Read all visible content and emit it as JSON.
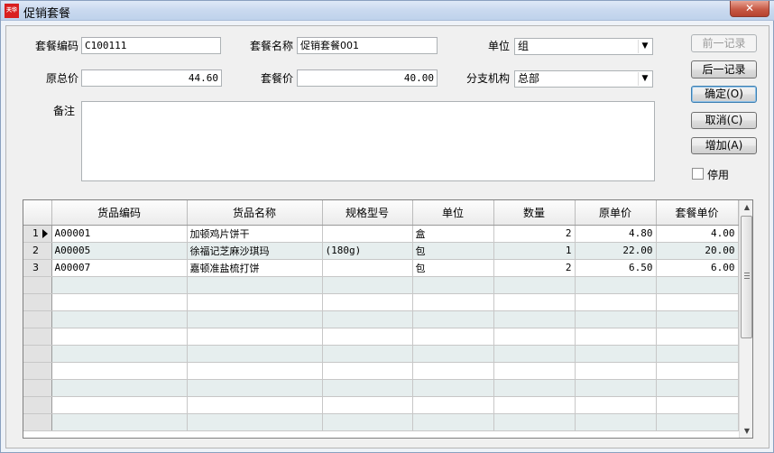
{
  "window": {
    "title": "促销套餐",
    "app_icon_text": "天华",
    "close_glyph": "✕"
  },
  "form": {
    "code_label": "套餐编码",
    "code_value": "C100111",
    "name_label": "套餐名称",
    "name_value": "促销套餐001",
    "unit_label": "单位",
    "unit_value": "组",
    "orig_total_label": "原总价",
    "orig_total_value": "44.60",
    "price_label": "套餐价",
    "price_value": "40.00",
    "branch_label": "分支机构",
    "branch_value": "总部",
    "remark_label": "备注",
    "remark_value": ""
  },
  "buttons": {
    "prev": "前一记录",
    "next": "后一记录",
    "ok": "确定(O)",
    "cancel": "取消(C)",
    "add": "增加(A)"
  },
  "disabled_checkbox": {
    "label": "停用",
    "checked": false
  },
  "grid": {
    "columns": [
      "货品编码",
      "货品名称",
      "规格型号",
      "单位",
      "数量",
      "原单价",
      "套餐单价"
    ],
    "rows": [
      {
        "no": "1",
        "code": "A00001",
        "name": "加顿鸡片饼干",
        "spec": "",
        "unit": "盒",
        "qty": "2",
        "orig": "4.80",
        "pkg": "4.00"
      },
      {
        "no": "2",
        "code": "A00005",
        "name": "徐福记芝麻沙琪玛",
        "spec": "(180g)",
        "unit": "包",
        "qty": "1",
        "orig": "22.00",
        "pkg": "20.00"
      },
      {
        "no": "3",
        "code": "A00007",
        "name": "嘉顿准盐梳打饼",
        "spec": "",
        "unit": "包",
        "qty": "2",
        "orig": "6.50",
        "pkg": "6.00"
      }
    ],
    "empty_rows": 9,
    "current_row": "1"
  },
  "icons": {
    "row_pointer": "row-pointer-icon",
    "dropdown": "chevron-down-icon",
    "scroll_up": "scroll-up-icon",
    "scroll_down": "scroll-down-icon"
  }
}
